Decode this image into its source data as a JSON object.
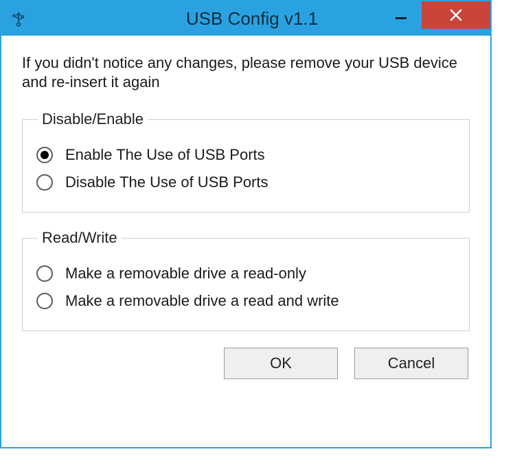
{
  "window": {
    "title": "USB Config v1.1",
    "accent_color": "#2aa2e2",
    "close_color": "#c9453a",
    "icon": "usb-icon"
  },
  "instruction": "If you didn't notice any changes, please remove your USB device and re-insert it again",
  "groups": {
    "disable_enable": {
      "legend": "Disable/Enable",
      "options": [
        {
          "label": "Enable The Use of USB Ports",
          "checked": true
        },
        {
          "label": "Disable The Use of USB Ports",
          "checked": false
        }
      ]
    },
    "read_write": {
      "legend": "Read/Write",
      "options": [
        {
          "label": "Make a removable drive a read-only",
          "checked": false
        },
        {
          "label": "Make a removable drive a read and write",
          "checked": false
        }
      ]
    }
  },
  "buttons": {
    "ok": "OK",
    "cancel": "Cancel"
  }
}
